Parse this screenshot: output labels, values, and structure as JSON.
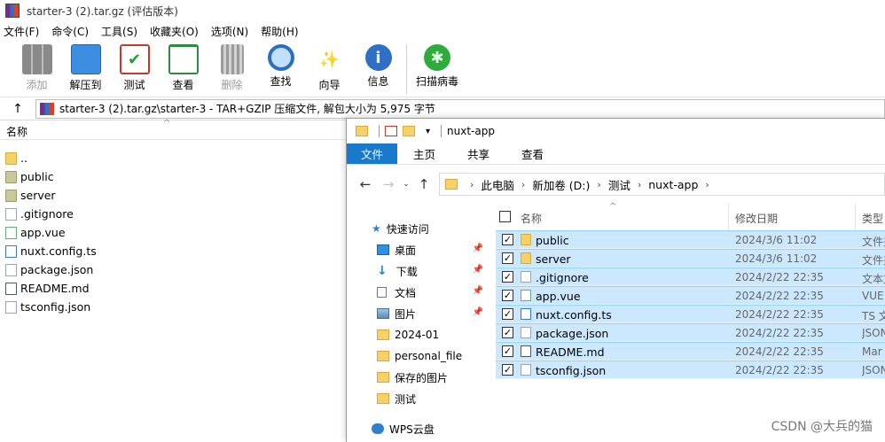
{
  "winrar": {
    "title": "starter-3 (2).tar.gz (评估版本)",
    "menu": [
      "文件(F)",
      "命令(C)",
      "工具(S)",
      "收藏夹(O)",
      "选项(N)",
      "帮助(H)"
    ],
    "toolbar": [
      {
        "label": "添加",
        "icon": "books-icon",
        "disabled": true
      },
      {
        "label": "解压到",
        "icon": "extract-folder-icon",
        "disabled": false
      },
      {
        "label": "测试",
        "icon": "clipboard-check-icon",
        "disabled": false
      },
      {
        "label": "查看",
        "icon": "open-book-icon",
        "disabled": false
      },
      {
        "label": "删除",
        "icon": "trash-icon",
        "disabled": true
      },
      {
        "label": "查找",
        "icon": "magnifier-icon",
        "disabled": false
      },
      {
        "label": "向导",
        "icon": "magic-wand-icon",
        "disabled": false
      },
      {
        "label": "信息",
        "icon": "info-icon",
        "disabled": false
      },
      {
        "label": "扫描病毒",
        "icon": "bug-icon",
        "disabled": false
      }
    ],
    "address": "starter-3 (2).tar.gz\\starter-3 - TAR+GZIP 压缩文件, 解包大小为 5,975 字节",
    "column_name": "名称",
    "files": [
      {
        "name": "..",
        "icon": "folder"
      },
      {
        "name": "public",
        "icon": "folder-green"
      },
      {
        "name": "server",
        "icon": "folder-green"
      },
      {
        "name": ".gitignore",
        "icon": "doc"
      },
      {
        "name": "app.vue",
        "icon": "vue"
      },
      {
        "name": "nuxt.config.ts",
        "icon": "ts"
      },
      {
        "name": "package.json",
        "icon": "doc"
      },
      {
        "name": "README.md",
        "icon": "md"
      },
      {
        "name": "tsconfig.json",
        "icon": "doc"
      }
    ]
  },
  "explorer": {
    "title": "nuxt-app",
    "ribbon_tabs": [
      "文件",
      "主页",
      "共享",
      "查看"
    ],
    "breadcrumb": [
      "此电脑",
      "新加卷 (D:)",
      "测试",
      "nuxt-app"
    ],
    "nav": {
      "quick_access": "快速访问",
      "items": [
        {
          "label": "桌面",
          "icon": "desktop-icon",
          "pinned": true
        },
        {
          "label": "下载",
          "icon": "download-arrow-icon",
          "pinned": true
        },
        {
          "label": "文档",
          "icon": "document-icon",
          "pinned": true
        },
        {
          "label": "图片",
          "icon": "pictures-icon",
          "pinned": true
        },
        {
          "label": "2024-01",
          "icon": "folder-icon",
          "pinned": false
        },
        {
          "label": "personal_file",
          "icon": "folder-icon",
          "pinned": false
        },
        {
          "label": "保存的图片",
          "icon": "folder-icon",
          "pinned": false
        },
        {
          "label": "测试",
          "icon": "folder-icon",
          "pinned": false
        }
      ],
      "cloud": "WPS云盘"
    },
    "columns": {
      "name": "名称",
      "date": "修改日期",
      "type": "类型"
    },
    "files": [
      {
        "name": "public",
        "date": "2024/3/6 11:02",
        "type": "文件夹",
        "icon": "folder"
      },
      {
        "name": "server",
        "date": "2024/3/6 11:02",
        "type": "文件夹",
        "icon": "folder"
      },
      {
        "name": ".gitignore",
        "date": "2024/2/22 22:35",
        "type": "文本文档",
        "icon": "doc"
      },
      {
        "name": "app.vue",
        "date": "2024/2/22 22:35",
        "type": "VUE",
        "icon": "vue"
      },
      {
        "name": "nuxt.config.ts",
        "date": "2024/2/22 22:35",
        "type": "TS 文件",
        "icon": "ts"
      },
      {
        "name": "package.json",
        "date": "2024/2/22 22:35",
        "type": "JSON",
        "icon": "doc"
      },
      {
        "name": "README.md",
        "date": "2024/2/22 22:35",
        "type": "Mar",
        "icon": "md"
      },
      {
        "name": "tsconfig.json",
        "date": "2024/2/22 22:35",
        "type": "JSON",
        "icon": "doc"
      }
    ]
  },
  "watermark": "CSDN @大兵的猫"
}
